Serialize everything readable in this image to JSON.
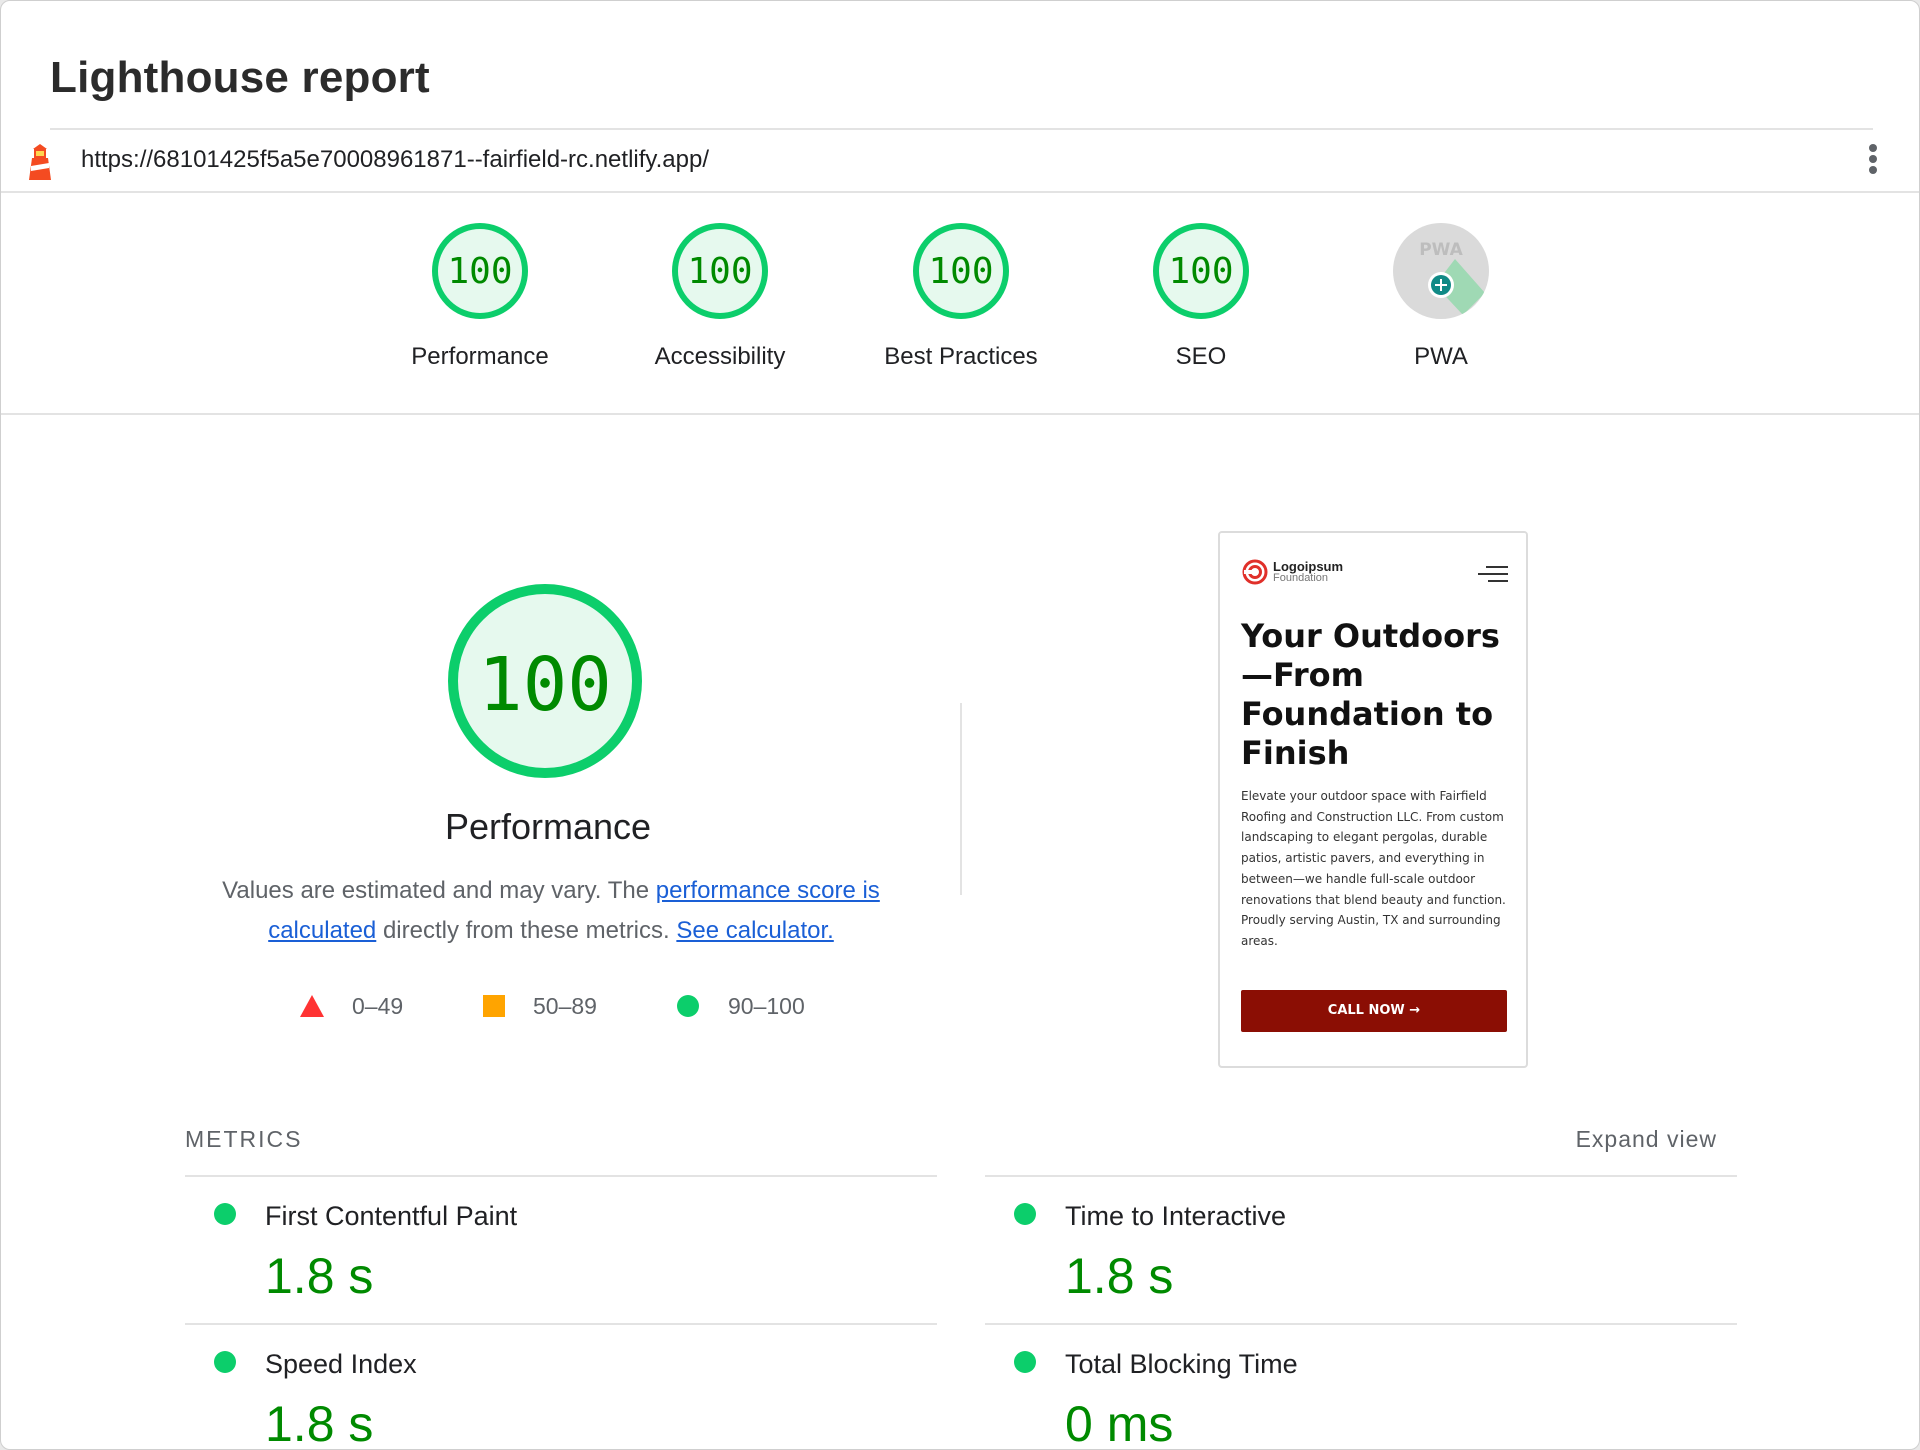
{
  "header": {
    "title": "Lighthouse report",
    "url": "https://68101425f5a5e70008961871--fairfield-rc.netlify.app/"
  },
  "scores": [
    {
      "label": "Performance",
      "score": "100"
    },
    {
      "label": "Accessibility",
      "score": "100"
    },
    {
      "label": "Best Practices",
      "score": "100"
    },
    {
      "label": "SEO",
      "score": "100"
    },
    {
      "label": "PWA",
      "badge": "PWA"
    }
  ],
  "performance": {
    "score": "100",
    "title": "Performance",
    "desc_prefix": "Values are estimated and may vary. The ",
    "link1": "performance score is calculated",
    "desc_mid": " directly from these metrics. ",
    "link2": "See calculator.",
    "legend": [
      {
        "shape": "triangle",
        "range": "0–49",
        "color": "#ff3333"
      },
      {
        "shape": "square",
        "range": "50–89",
        "color": "#ffa400"
      },
      {
        "shape": "circle",
        "range": "90–100",
        "color": "#0cce6b"
      }
    ]
  },
  "screenshot": {
    "logo_name": "Logoipsum",
    "logo_sub": "Foundation",
    "hero_title": "Your Outdoors —From Foundation to Finish",
    "hero_body": "Elevate your outdoor space with Fairfield Roofing and Construction LLC. From custom landscaping to elegant pergolas, durable patios, artistic pavers, and everything in between—we handle full-scale outdoor renovations that blend beauty and function. Proudly serving Austin, TX and surrounding areas.",
    "cta": "CALL NOW →",
    "cta_color": "#8b0e04"
  },
  "metrics": {
    "heading": "METRICS",
    "expand": "Expand view",
    "items": [
      {
        "name": "First Contentful Paint",
        "value": "1.8 s"
      },
      {
        "name": "Time to Interactive",
        "value": "1.8 s"
      },
      {
        "name": "Speed Index",
        "value": "1.8 s"
      },
      {
        "name": "Total Blocking Time",
        "value": "0 ms"
      }
    ]
  },
  "colors": {
    "pass": "#0cce6b",
    "pass_text": "#008a00",
    "link": "#1a5fd6"
  }
}
